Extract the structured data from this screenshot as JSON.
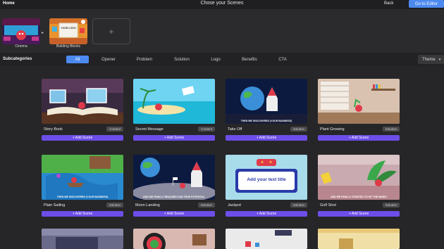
{
  "header": {
    "home_label": "Home",
    "title": "Chose your Scenes",
    "back_label": "Back",
    "editor_button_label": "Go to Editor"
  },
  "scenes": [
    {
      "label": "Cinema"
    },
    {
      "label": "Building Blocks",
      "thumb_text": "YOUR LOGO"
    }
  ],
  "add_scene_slot_icon": "plus-icon",
  "subcategories": {
    "label": "Subcategories",
    "tabs": [
      "All",
      "Opener",
      "Problem",
      "Solution",
      "Logo",
      "Benefits",
      "CTA"
    ],
    "active_tab": "All",
    "theme_label": "Theme"
  },
  "cards": [
    {
      "name": "Story Book",
      "tag": "Content",
      "button": "+ Add Scene"
    },
    {
      "name": "Secret Message",
      "tag": "Content",
      "button": "+ Add Scene"
    },
    {
      "name": "Take Off",
      "tag": "Solution",
      "button": "+ Add Scene",
      "caption": "THEN WE DISCOVERED (YOUR BUSINESS)"
    },
    {
      "name": "Plant Growing",
      "tag": "Solution",
      "button": "+ Add Scene"
    },
    {
      "name": "Plain Sailing",
      "tag": "Solution",
      "button": "+ Add Scene",
      "caption": "THEN WE DISCOVERED (YOUR BUSINESS)"
    },
    {
      "name": "Moon Landing",
      "tag": "Solution",
      "button": "+ Add Scene",
      "caption": "AND WE FINALLY REACHED OUR TRUE POTENTIAL"
    },
    {
      "name": "Jackpot",
      "tag": "Solution",
      "button": "+ Add Scene",
      "thumb_text": "Add your text title"
    },
    {
      "name": "Golf Shot",
      "tag": "Solution",
      "button": "+ Add Scene",
      "caption": "AND WE FINALLY STARTED TO HIT THE MARK!"
    }
  ],
  "colors": {
    "accent_blue": "#4d8af0",
    "add_button_purple": "#6d4ee8",
    "background": "#262628"
  }
}
